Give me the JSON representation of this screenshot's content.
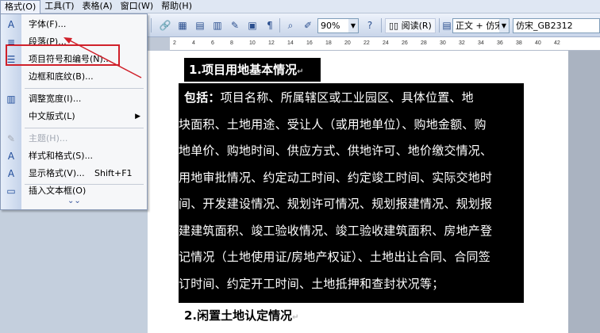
{
  "menubar": {
    "items": [
      {
        "label": "格式(O)"
      },
      {
        "label": "工具(T)"
      },
      {
        "label": "表格(A)"
      },
      {
        "label": "窗口(W)"
      },
      {
        "label": "帮助(H)"
      }
    ]
  },
  "toolbar": {
    "zoom": "90%",
    "read_button": "阅读(R)",
    "style": "正文 + 仿宋",
    "font": "仿宋_GB2312"
  },
  "ruler": {
    "ticks": [
      "2",
      "4",
      "6",
      "8",
      "10",
      "12",
      "14",
      "16",
      "18",
      "20",
      "22",
      "24",
      "26",
      "28",
      "30",
      "32",
      "34",
      "36",
      "38",
      "40",
      "42"
    ]
  },
  "format_menu": {
    "items": [
      {
        "label": "字体(F)...",
        "icon": "font-icon",
        "enabled": true
      },
      {
        "label": "段落(P)...",
        "icon": "paragraph-icon",
        "enabled": true
      },
      {
        "label": "项目符号和编号(N)...",
        "icon": "bullets-icon",
        "enabled": true
      },
      {
        "label": "边框和底纹(B)...",
        "icon": "",
        "enabled": true
      },
      {
        "label": "调整宽度(I)...",
        "icon": "width-icon",
        "enabled": true
      },
      {
        "label": "中文版式(L)",
        "icon": "",
        "enabled": true,
        "submenu": true
      },
      {
        "label": "主题(H)...",
        "icon": "theme-icon",
        "enabled": false
      },
      {
        "label": "样式和格式(S)...",
        "icon": "styles-icon",
        "enabled": true
      },
      {
        "label": "显示格式(V)...",
        "icon": "reveal-icon",
        "enabled": true,
        "shortcut": "Shift+F1"
      },
      {
        "label": "插入文本框(O)",
        "icon": "textbox-icon",
        "enabled": true
      }
    ],
    "highlighted": "段落(P)..."
  },
  "document": {
    "heading1": "1.项目用地基本情况",
    "lines": [
      {
        "bold": "包括：",
        "text": "项目名称、所属辖区或工业园区、具体位置、地"
      },
      {
        "bold": "",
        "text": "块面积、土地用途、受让人（或用地单位）、购地金额、购"
      },
      {
        "bold": "",
        "text": "地单价、购地时间、供应方式、供地许可、地价缴交情况、"
      },
      {
        "bold": "",
        "text": "用地审批情况、约定动工时间、约定竣工时间、实际交地时"
      },
      {
        "bold": "",
        "text": "间、开发建设情况、规划许可情况、规划报建情况、规划报"
      },
      {
        "bold": "",
        "text": "建建筑面积、竣工验收情况、竣工验收建筑面积、房地产登"
      },
      {
        "bold": "",
        "text": "记情况（土地使用证/房地产权证）、土地出让合同、合同签"
      },
      {
        "bold": "",
        "text": "订时间、约定开工时间、土地抵押和查封状况等；"
      }
    ],
    "heading2": "2.闲置土地认定情况"
  },
  "colors": {
    "menu_bg": "#f6f7f9",
    "highlight_border": "#d0212b",
    "selection": "#000000"
  }
}
